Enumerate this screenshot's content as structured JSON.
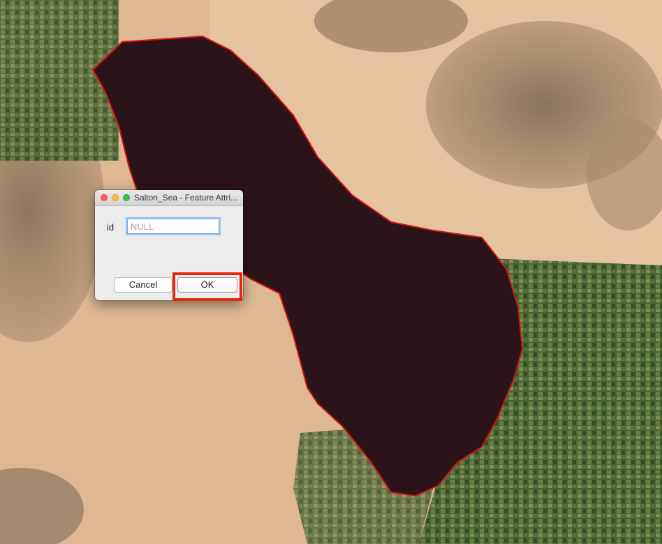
{
  "map": {
    "colors": {
      "desert_light": "#e3bf98",
      "desert_mid": "#c9a27a",
      "mountain": "#9b8468",
      "lake": "#2a141a",
      "lake_outline": "#d21414",
      "farmland": "#4a6a34",
      "farmland_dark": "#2f4a26"
    }
  },
  "dialog": {
    "title": "Salton_Sea - Feature Attri...",
    "field_label": "id",
    "field_value": "",
    "field_placeholder": "NULL",
    "cancel_label": "Cancel",
    "ok_label": "OK"
  },
  "highlight": {
    "target": "ok-button",
    "color": "#e8260f"
  }
}
